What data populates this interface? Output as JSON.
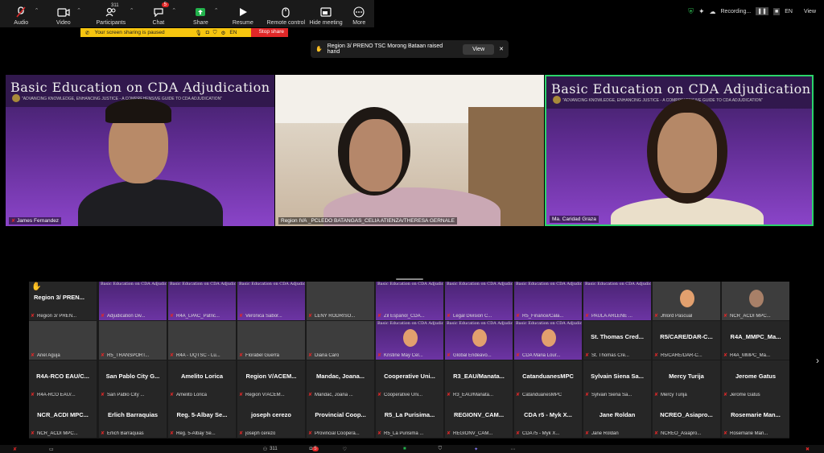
{
  "toolbar": {
    "audio": "Audio",
    "video": "Video",
    "participants": "Participants",
    "participants_count": "311",
    "chat": "Chat",
    "chat_badge": "5",
    "share": "Share",
    "resume": "Resume",
    "remote": "Remote control",
    "hide": "Hide meeting",
    "more": "More"
  },
  "share_bar": {
    "msg": "Your screen sharing is paused",
    "lang": "EN",
    "stop": "Stop share"
  },
  "status": {
    "recording": "Recording...",
    "lang": "EN",
    "view": "View"
  },
  "notification": {
    "text": "Region 3/ PRENO TSC Morong Bataan raised hand",
    "view": "View"
  },
  "banner": {
    "title": "Basic Education on CDA Adjudication",
    "subtitle": "\"ADVANCING KNOWLEDGE, ENHANCING JUSTICE - A COMPREHENSIVE GUIDE TO CDA ADJUDICATION\""
  },
  "main_videos": [
    {
      "name": "James Fernandez"
    },
    {
      "name": "Region IVA _PCLEDO BATANGAS_CELIA ATIENZA/THERESA GERNALE"
    },
    {
      "name": "Ma. Caridad Graza"
    }
  ],
  "gallery": [
    {
      "big": "Region 3/ PREN...",
      "small": "Region 3/ PREN..."
    },
    {
      "small": "Adjudication Div..."
    },
    {
      "small": "R4A_LPAC_Patric..."
    },
    {
      "small": "Veronica Sabor..."
    },
    {
      "small": "LENY RODRISO..."
    },
    {
      "small": "Zil Espanol_CDA..."
    },
    {
      "small": "Legal Division C..."
    },
    {
      "small": "R5_Finance/Cala..."
    },
    {
      "small": "PAULA ARLENE ..."
    },
    {
      "small": "Jhlord Pascual"
    },
    {
      "small": "NCR_ACDI MPC..."
    },
    {
      "small": "Ariel Aguja"
    },
    {
      "small": "R5_TRANSPORT..."
    },
    {
      "small": "R4A - UQTSC - Lu..."
    },
    {
      "small": "Florabel Guerra"
    },
    {
      "small": "Diana Caro"
    },
    {
      "small": "Kristine May Cel..."
    },
    {
      "small": "Global Endeavo..."
    },
    {
      "small": "CDA Maria Lour..."
    },
    {
      "big": "St. Thomas Cred...",
      "small": "St. Thomas Cre..."
    },
    {
      "big": "R5/CARE/DAR-C...",
      "small": "R5/CARE/DAR-C..."
    },
    {
      "big": "R4A_MMPC_Ma...",
      "small": "R4A_MMPC_Ma..."
    },
    {
      "big": "R4A-RCO EAU/C...",
      "small": "R4A-RCO EAU/..."
    },
    {
      "big": "San Pablo City G...",
      "small": "San Pablo City ..."
    },
    {
      "big": "Amelito Lorica",
      "small": "Amelito Lorica"
    },
    {
      "big": "Region V/ACEM...",
      "small": "Region V/ACEM..."
    },
    {
      "big": "Mandac, Joana...",
      "small": "Mandac, Joana ..."
    },
    {
      "big": "Cooperative Uni...",
      "small": "Cooperative Uni..."
    },
    {
      "big": "R3_EAU/Manata...",
      "small": "R3_EAU/Manata..."
    },
    {
      "big": "CatanduanesMPC",
      "small": "CatanduanesMPC"
    },
    {
      "big": "Sylvain Siena Sa...",
      "small": "Sylvain Siena Sa..."
    },
    {
      "big": "Mercy Turija",
      "small": "Mercy Turija"
    },
    {
      "big": "Jerome Gatus",
      "small": "Jerome Gatus"
    },
    {
      "big": "NCR_ACDI MPC...",
      "small": "NCR_ACDI MPC..."
    },
    {
      "big": "Erlich Barraquias",
      "small": "Erlich Barraquias"
    },
    {
      "big": "Reg. 5-Albay Se...",
      "small": "Reg. 5-Albay Se..."
    },
    {
      "big": "joseph cerezo",
      "small": "joseph cerezo"
    },
    {
      "big": "Provincial Coop...",
      "small": "Provincial Coopera..."
    },
    {
      "big": "R5_La Purisima...",
      "small": "R5_La Purisima ..."
    },
    {
      "big": "REGIONV_CAM...",
      "small": "REGIONV_CAM..."
    },
    {
      "big": "CDA r5 - Myk X...",
      "small": "CDA r5 - Myk X..."
    },
    {
      "big": "Jane Roldan",
      "small": "Jane Roldan"
    },
    {
      "big": "NCREO_Asiapro...",
      "small": "NCREO_Asiapro..."
    },
    {
      "big": "Rosemarie Man...",
      "small": "Rosemarie Man..."
    }
  ],
  "bottom": {
    "participants_count": "311",
    "chat_badge": "5"
  }
}
